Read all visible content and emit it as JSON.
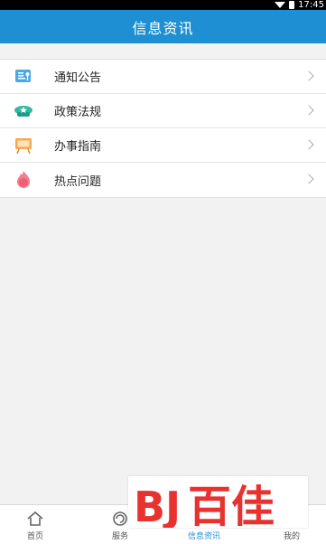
{
  "status_bar": {
    "time": "17:45"
  },
  "header": {
    "title": "信息资讯"
  },
  "menu": {
    "items": [
      {
        "label": "通知公告",
        "icon": "notice-board-icon"
      },
      {
        "label": "政策法规",
        "icon": "police-cap-icon"
      },
      {
        "label": "办事指南",
        "icon": "easel-board-icon"
      },
      {
        "label": "热点问题",
        "icon": "hot-flame-icon"
      }
    ]
  },
  "bottom_nav": {
    "items": [
      {
        "label": "首页",
        "icon": "home-icon"
      },
      {
        "label": "服务",
        "icon": "service-icon"
      },
      {
        "label": "信息资讯",
        "icon": "info-icon"
      },
      {
        "label": "我的",
        "icon": "user-icon"
      }
    ]
  },
  "watermark": {
    "text": "百佳",
    "logo": "BJ"
  },
  "colors": {
    "primary": "#1e8fd3",
    "background": "#f2f2f2",
    "watermark_red": "#e8322f"
  }
}
